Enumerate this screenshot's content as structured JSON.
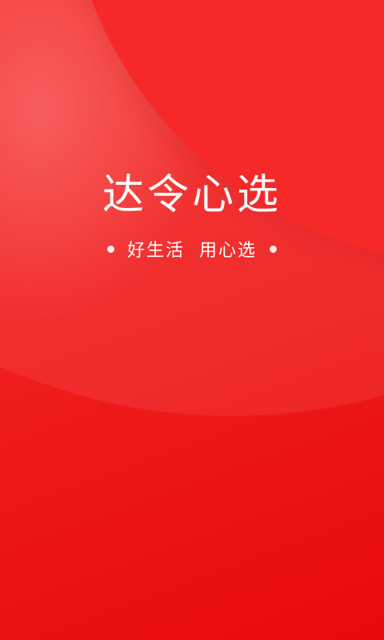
{
  "splash": {
    "brand_name": "达令心选",
    "slogan": "好生活  用心选"
  },
  "colors": {
    "background": "#f01f1f",
    "accent": "#ffffff"
  }
}
